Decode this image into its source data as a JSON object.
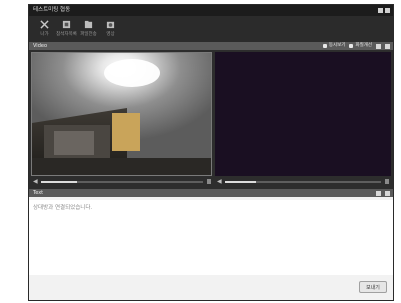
{
  "window": {
    "title": "테스트미팅 협동"
  },
  "toolbar": {
    "items": [
      {
        "label": "나가",
        "icon": "exit-icon"
      },
      {
        "label": "참석자목록",
        "icon": "user-list-icon"
      },
      {
        "label": "파일전송",
        "icon": "file-transfer-icon"
      },
      {
        "label": "영상",
        "icon": "video-icon"
      }
    ]
  },
  "video_section": {
    "label": "Video",
    "option_a": "동시보기",
    "option_b": "화질개선",
    "local_progress": 0.22,
    "remote_progress": 0.2
  },
  "text_section": {
    "label": "Text",
    "message": "상대방과 연결되었습니다.",
    "send_label": "보내기"
  },
  "colors": {
    "titlebar": "#1c1c1c",
    "toolbar": "#2b2b2b",
    "remote_video_bg": "#1a0f22"
  }
}
